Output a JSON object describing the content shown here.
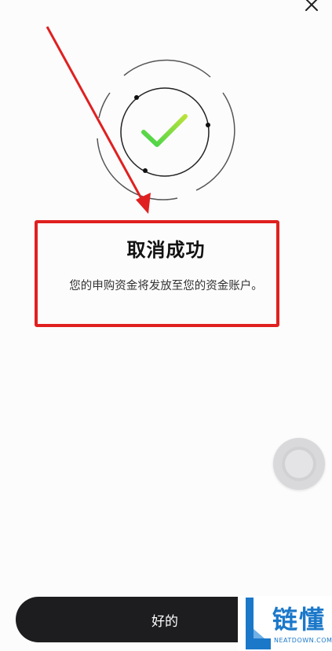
{
  "dialog": {
    "close_label": "×",
    "title": "取消成功",
    "message": "您的申购资金将发放至您的资金账户。"
  },
  "footer": {
    "confirm_label": "好的"
  },
  "watermark": {
    "title": "链懂",
    "subtitle": "NEATDOWN.COM"
  },
  "colors": {
    "annotation_red": "#e02020",
    "check_green_start": "#3fd44a",
    "check_green_end": "#b9e23a",
    "button_bg": "#1d1d1f",
    "watermark_blue": "#1b78c9"
  },
  "icons": {
    "close": "close-icon",
    "success": "checkmark-icon",
    "floating": "assistive-touch-icon",
    "arrow": "annotation-arrow-icon"
  }
}
